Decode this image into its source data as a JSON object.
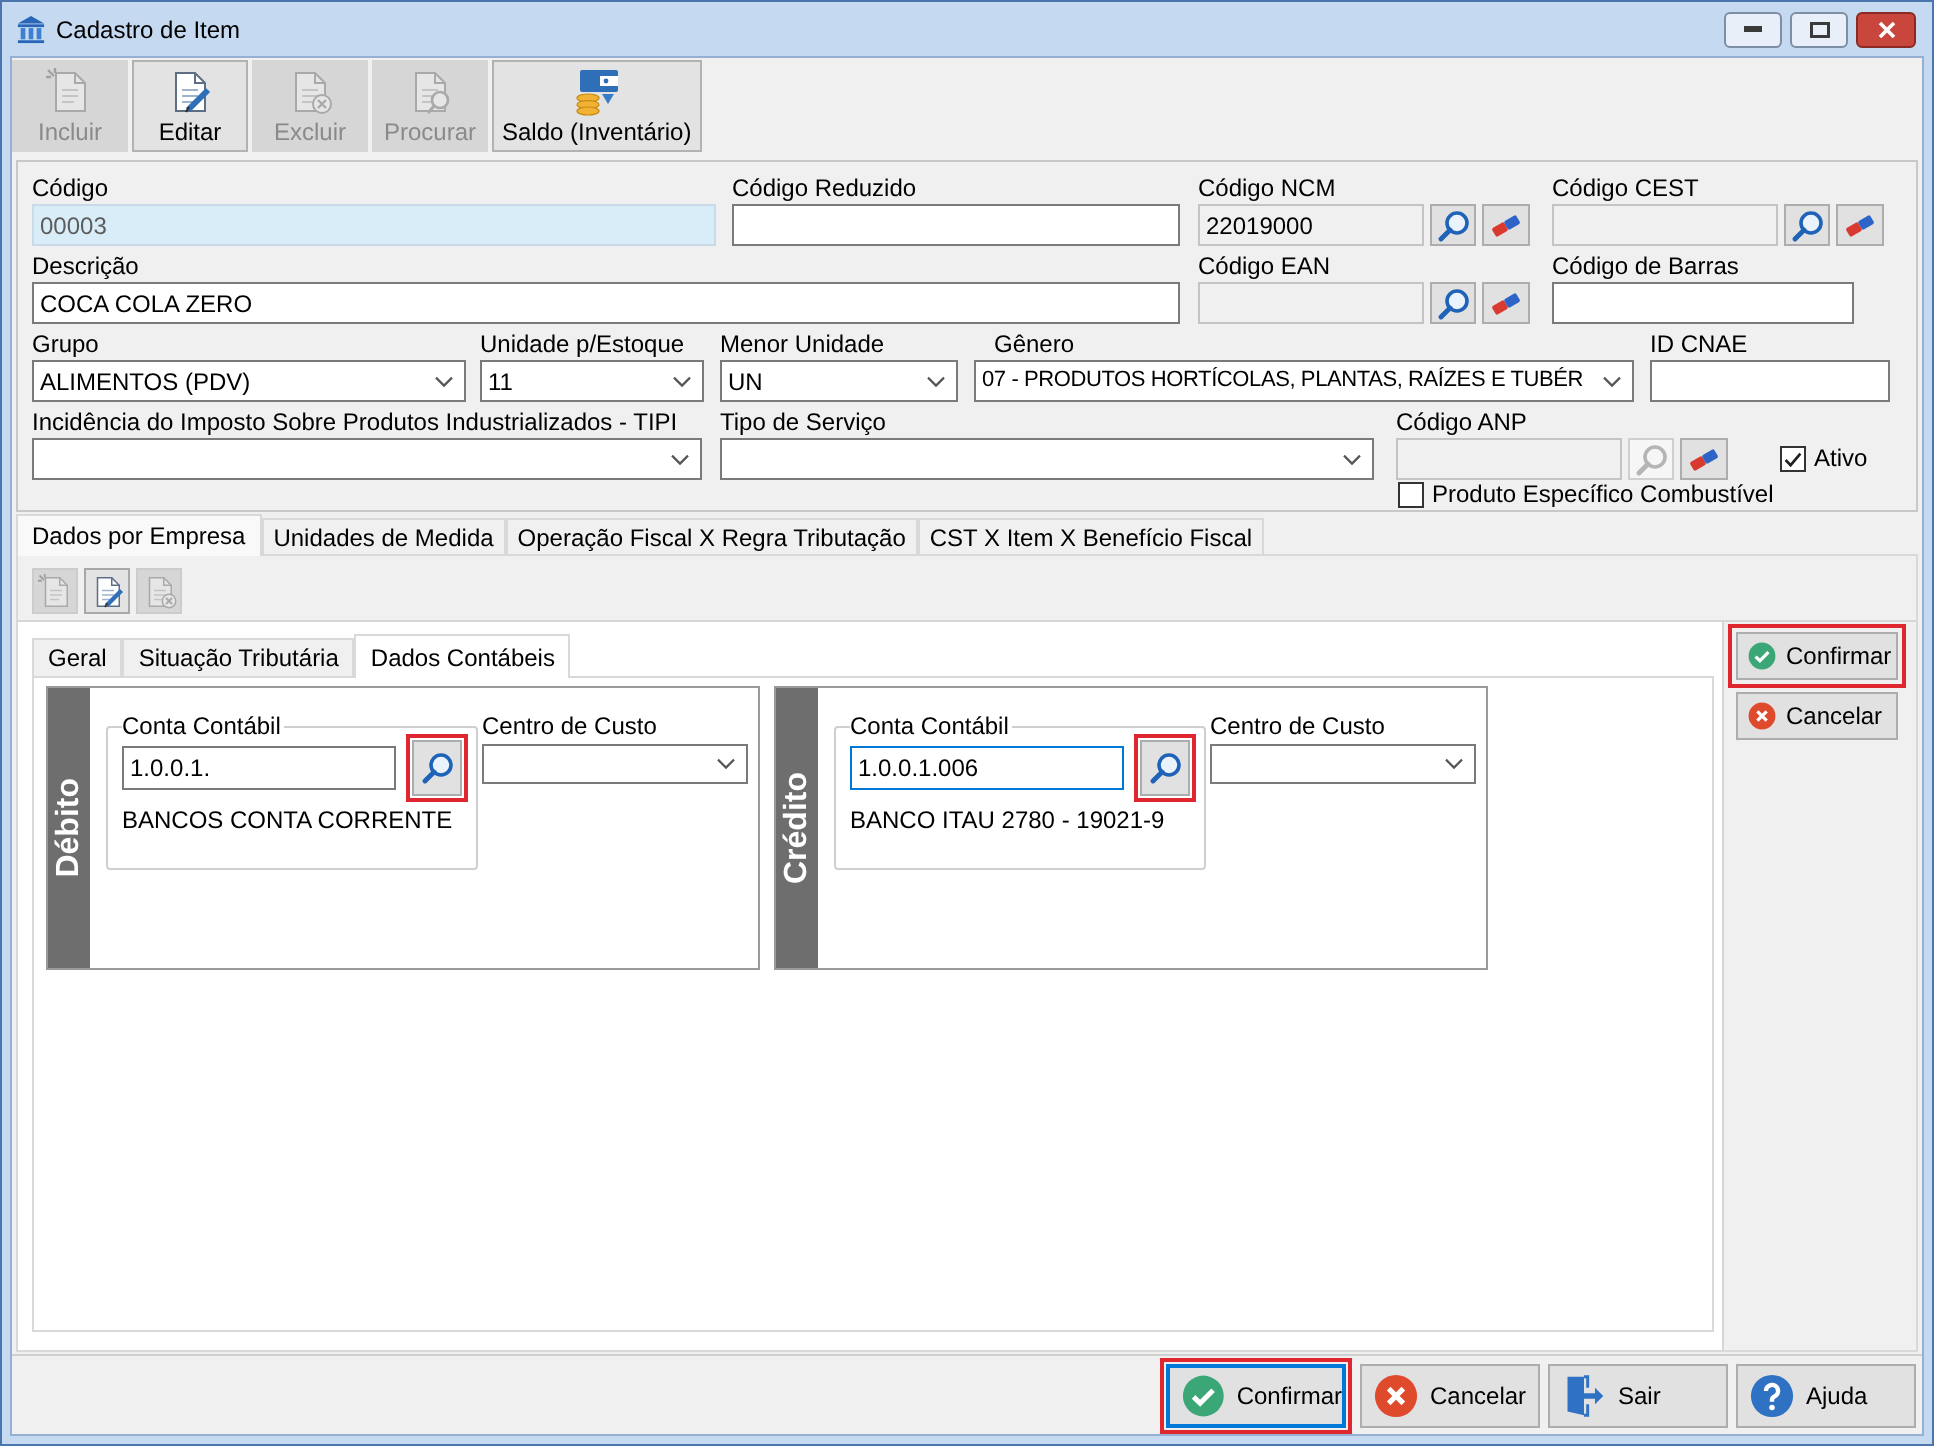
{
  "window": {
    "title": "Cadastro de Item"
  },
  "toolbar": [
    {
      "kind": "new",
      "label": "Incluir",
      "disabled": true
    },
    {
      "kind": "edit",
      "label": "Editar",
      "disabled": false
    },
    {
      "kind": "delete",
      "label": "Excluir",
      "disabled": true
    },
    {
      "kind": "search",
      "label": "Procurar",
      "disabled": true
    },
    {
      "kind": "inventory",
      "label": "Saldo (Inventário)",
      "disabled": false
    }
  ],
  "form": {
    "codigo": {
      "label": "Código",
      "value": "00003"
    },
    "codigo_reduzido": {
      "label": "Código Reduzido"
    },
    "codigo_ncm": {
      "label": "Código NCM",
      "value": "22019000",
      "disabled": true,
      "search_disabled": false
    },
    "codigo_cest": {
      "label": "Código CEST",
      "disabled": true,
      "search_disabled": false
    },
    "descricao": {
      "label": "Descrição",
      "value": "COCA COLA ZERO"
    },
    "codigo_ean": {
      "label": "Código EAN",
      "disabled": true,
      "search_disabled": false
    },
    "codigo_barras": {
      "label": "Código de Barras"
    },
    "grupo": {
      "label": "Grupo",
      "value": "ALIMENTOS (PDV)"
    },
    "unidade_estoque": {
      "label": "Unidade p/Estoque",
      "value": "11"
    },
    "menor_unidade": {
      "label": "Menor Unidade",
      "value": "UN"
    },
    "genero": {
      "label": "Gênero",
      "value": "07 - PRODUTOS HORTÍCOLAS, PLANTAS, RAÍZES E TUBÉR"
    },
    "id_cnae": {
      "label": "ID CNAE"
    },
    "tipi": {
      "label": "Incidência do Imposto Sobre Produtos Industrializados - TIPI"
    },
    "tipo_servico": {
      "label": "Tipo de Serviço"
    },
    "codigo_anp": {
      "label": "Código ANP",
      "disabled": true,
      "search_disabled": true
    },
    "ativo": {
      "label": "Ativo",
      "checked": true
    },
    "produto_combustivel": {
      "label": "Produto Específico Combustível",
      "checked": false
    }
  },
  "tabs": [
    {
      "label": "Dados por Empresa",
      "selected": true
    },
    {
      "label": "Unidades de Medida",
      "selected": false
    },
    {
      "label": "Operação Fiscal X Regra Tributação",
      "selected": false
    },
    {
      "label": "CST X Item X Benefício Fiscal",
      "selected": false
    }
  ],
  "tab_toolbar": [
    {
      "kind": "new",
      "disabled": true
    },
    {
      "kind": "edit",
      "disabled": false
    },
    {
      "kind": "delete",
      "disabled": true
    }
  ],
  "subtabs": [
    {
      "label": "Geral",
      "selected": false
    },
    {
      "label": "Situação Tributária",
      "selected": false
    },
    {
      "label": "Dados Contábeis",
      "selected": true
    }
  ],
  "accounts": [
    {
      "side": "Débito",
      "account_label": "Conta Contábil",
      "value": "1.0.0.1.",
      "description": "BANCOS CONTA CORRENTE",
      "focused": false,
      "search_highlighted": true,
      "cost_center_label": "Centro de Custo"
    },
    {
      "side": "Crédito",
      "account_label": "Conta Contábil",
      "value": "1.0.0.1.006",
      "description": "BANCO ITAU 2780 - 19021-9",
      "focused": true,
      "search_highlighted": true,
      "cost_center_label": "Centro de Custo"
    }
  ],
  "side_actions": [
    {
      "kind": "confirm",
      "label": "Confirmar",
      "highlighted": true
    },
    {
      "kind": "cancel",
      "label": "Cancelar",
      "highlighted": false
    }
  ],
  "footer": [
    {
      "kind": "confirm",
      "label": "Confirmar",
      "focused": true,
      "highlighted": true
    },
    {
      "kind": "cancel",
      "label": "Cancelar",
      "focused": false,
      "highlighted": false
    },
    {
      "kind": "exit",
      "label": "Sair",
      "focused": false,
      "highlighted": false
    },
    {
      "kind": "help",
      "label": "Ajuda",
      "focused": false,
      "highlighted": false
    }
  ]
}
